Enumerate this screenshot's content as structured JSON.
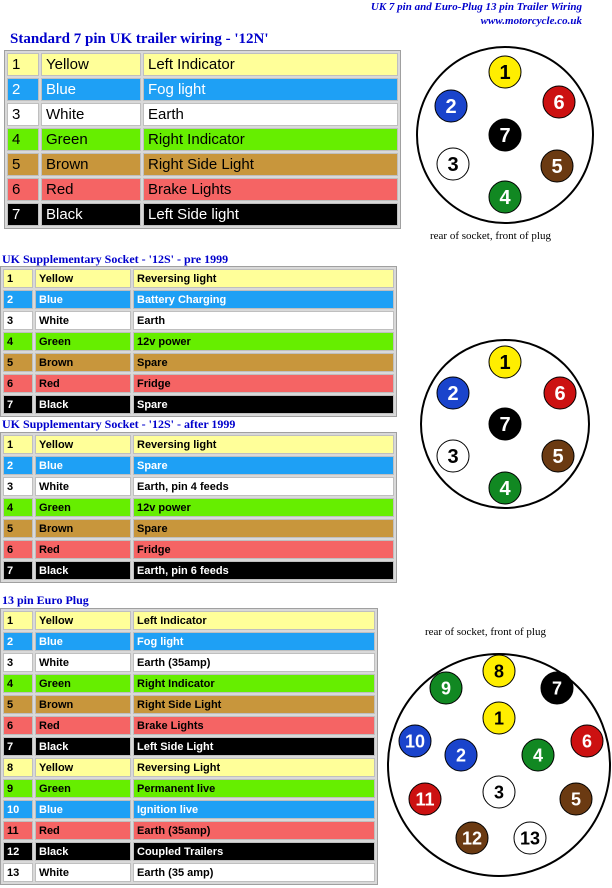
{
  "header": {
    "title": "UK 7 pin and Euro-Plug 13 pin Trailer Wiring",
    "site": "www.motorcycle.co.uk"
  },
  "colors": {
    "Yellow": {
      "bg": "#ffff99",
      "fg": "#000000"
    },
    "Blue": {
      "bg": "#1ea0f5",
      "fg": "#ffffff"
    },
    "White": {
      "bg": "#ffffff",
      "fg": "#000000"
    },
    "Green": {
      "bg": "#66ee00",
      "fg": "#000000"
    },
    "Brown": {
      "bg": "#c8963c",
      "fg": "#000000"
    },
    "Red": {
      "bg": "#f56464",
      "fg": "#000000"
    },
    "Black": {
      "bg": "#000000",
      "fg": "#ffffff"
    }
  },
  "pin_colors": {
    "Yellow": "#ffee00",
    "Blue": "#1a44cc",
    "White": "#ffffff",
    "Green": "#118822",
    "Brown": "#6b3a12",
    "Red": "#cc1111",
    "Black": "#000000"
  },
  "sections": [
    {
      "title": "Standard 7 pin UK trailer wiring - '12N'",
      "rows": [
        {
          "pin": "1",
          "color": "Yellow",
          "function": "Left Indicator"
        },
        {
          "pin": "2",
          "color": "Blue",
          "function": "Fog light"
        },
        {
          "pin": "3",
          "color": "White",
          "function": "Earth"
        },
        {
          "pin": "4",
          "color": "Green",
          "function": "Right Indicator"
        },
        {
          "pin": "5",
          "color": "Brown",
          "function": "Right Side Light"
        },
        {
          "pin": "6",
          "color": "Red",
          "function": "Brake Lights"
        },
        {
          "pin": "7",
          "color": "Black",
          "function": "Left Side light"
        }
      ]
    },
    {
      "title": "UK Supplementary Socket - '12S' - pre 1999",
      "rows": [
        {
          "pin": "1",
          "color": "Yellow",
          "function": "Reversing light"
        },
        {
          "pin": "2",
          "color": "Blue",
          "function": "Battery Charging"
        },
        {
          "pin": "3",
          "color": "White",
          "function": "Earth"
        },
        {
          "pin": "4",
          "color": "Green",
          "function": "12v power"
        },
        {
          "pin": "5",
          "color": "Brown",
          "function": "Spare"
        },
        {
          "pin": "6",
          "color": "Red",
          "function": "Fridge"
        },
        {
          "pin": "7",
          "color": "Black",
          "function": "Spare"
        }
      ]
    },
    {
      "title": "UK Supplementary Socket - '12S' - after 1999",
      "rows": [
        {
          "pin": "1",
          "color": "Yellow",
          "function": "Reversing light"
        },
        {
          "pin": "2",
          "color": "Blue",
          "function": "Spare"
        },
        {
          "pin": "3",
          "color": "White",
          "function": "Earth, pin 4 feeds"
        },
        {
          "pin": "4",
          "color": "Green",
          "function": "12v power"
        },
        {
          "pin": "5",
          "color": "Brown",
          "function": "Spare"
        },
        {
          "pin": "6",
          "color": "Red",
          "function": "Fridge"
        },
        {
          "pin": "7",
          "color": "Black",
          "function": "Earth, pin 6 feeds"
        }
      ]
    },
    {
      "title": "13 pin Euro Plug",
      "rows": [
        {
          "pin": "1",
          "color": "Yellow",
          "function": "Left Indicator"
        },
        {
          "pin": "2",
          "color": "Blue",
          "function": "Fog light"
        },
        {
          "pin": "3",
          "color": "White",
          "function": "Earth (35amp)"
        },
        {
          "pin": "4",
          "color": "Green",
          "function": "Right Indicator"
        },
        {
          "pin": "5",
          "color": "Brown",
          "function": "Right Side Light"
        },
        {
          "pin": "6",
          "color": "Red",
          "function": "Brake Lights"
        },
        {
          "pin": "7",
          "color": "Black",
          "function": "Left Side Light"
        },
        {
          "pin": "8",
          "color": "Yellow",
          "function": "Reversing Light"
        },
        {
          "pin": "9",
          "color": "Green",
          "function": "Permanent live"
        },
        {
          "pin": "10",
          "color": "Blue",
          "function": "Ignition live"
        },
        {
          "pin": "11",
          "color": "Red",
          "function": "Earth (35amp)"
        },
        {
          "pin": "12",
          "color": "Black",
          "function": "Coupled Trailers"
        },
        {
          "pin": "13",
          "color": "White",
          "function": "Earth (35 amp)"
        }
      ]
    }
  ],
  "diagrams": {
    "caption": "rear of socket, front of plug",
    "seven_pin": [
      {
        "pin": "1",
        "color": "Yellow"
      },
      {
        "pin": "2",
        "color": "Blue"
      },
      {
        "pin": "3",
        "color": "White"
      },
      {
        "pin": "4",
        "color": "Green"
      },
      {
        "pin": "5",
        "color": "Brown"
      },
      {
        "pin": "6",
        "color": "Red"
      },
      {
        "pin": "7",
        "color": "Black"
      }
    ],
    "thirteen_pin": [
      {
        "pin": "1",
        "color": "Yellow"
      },
      {
        "pin": "2",
        "color": "Blue"
      },
      {
        "pin": "3",
        "color": "White"
      },
      {
        "pin": "4",
        "color": "Green"
      },
      {
        "pin": "5",
        "color": "Brown"
      },
      {
        "pin": "6",
        "color": "Red"
      },
      {
        "pin": "7",
        "color": "Black"
      },
      {
        "pin": "8",
        "color": "Yellow"
      },
      {
        "pin": "9",
        "color": "Green"
      },
      {
        "pin": "10",
        "color": "Blue"
      },
      {
        "pin": "11",
        "color": "Red"
      },
      {
        "pin": "12",
        "color": "Brown"
      },
      {
        "pin": "13",
        "color": "White"
      }
    ]
  }
}
